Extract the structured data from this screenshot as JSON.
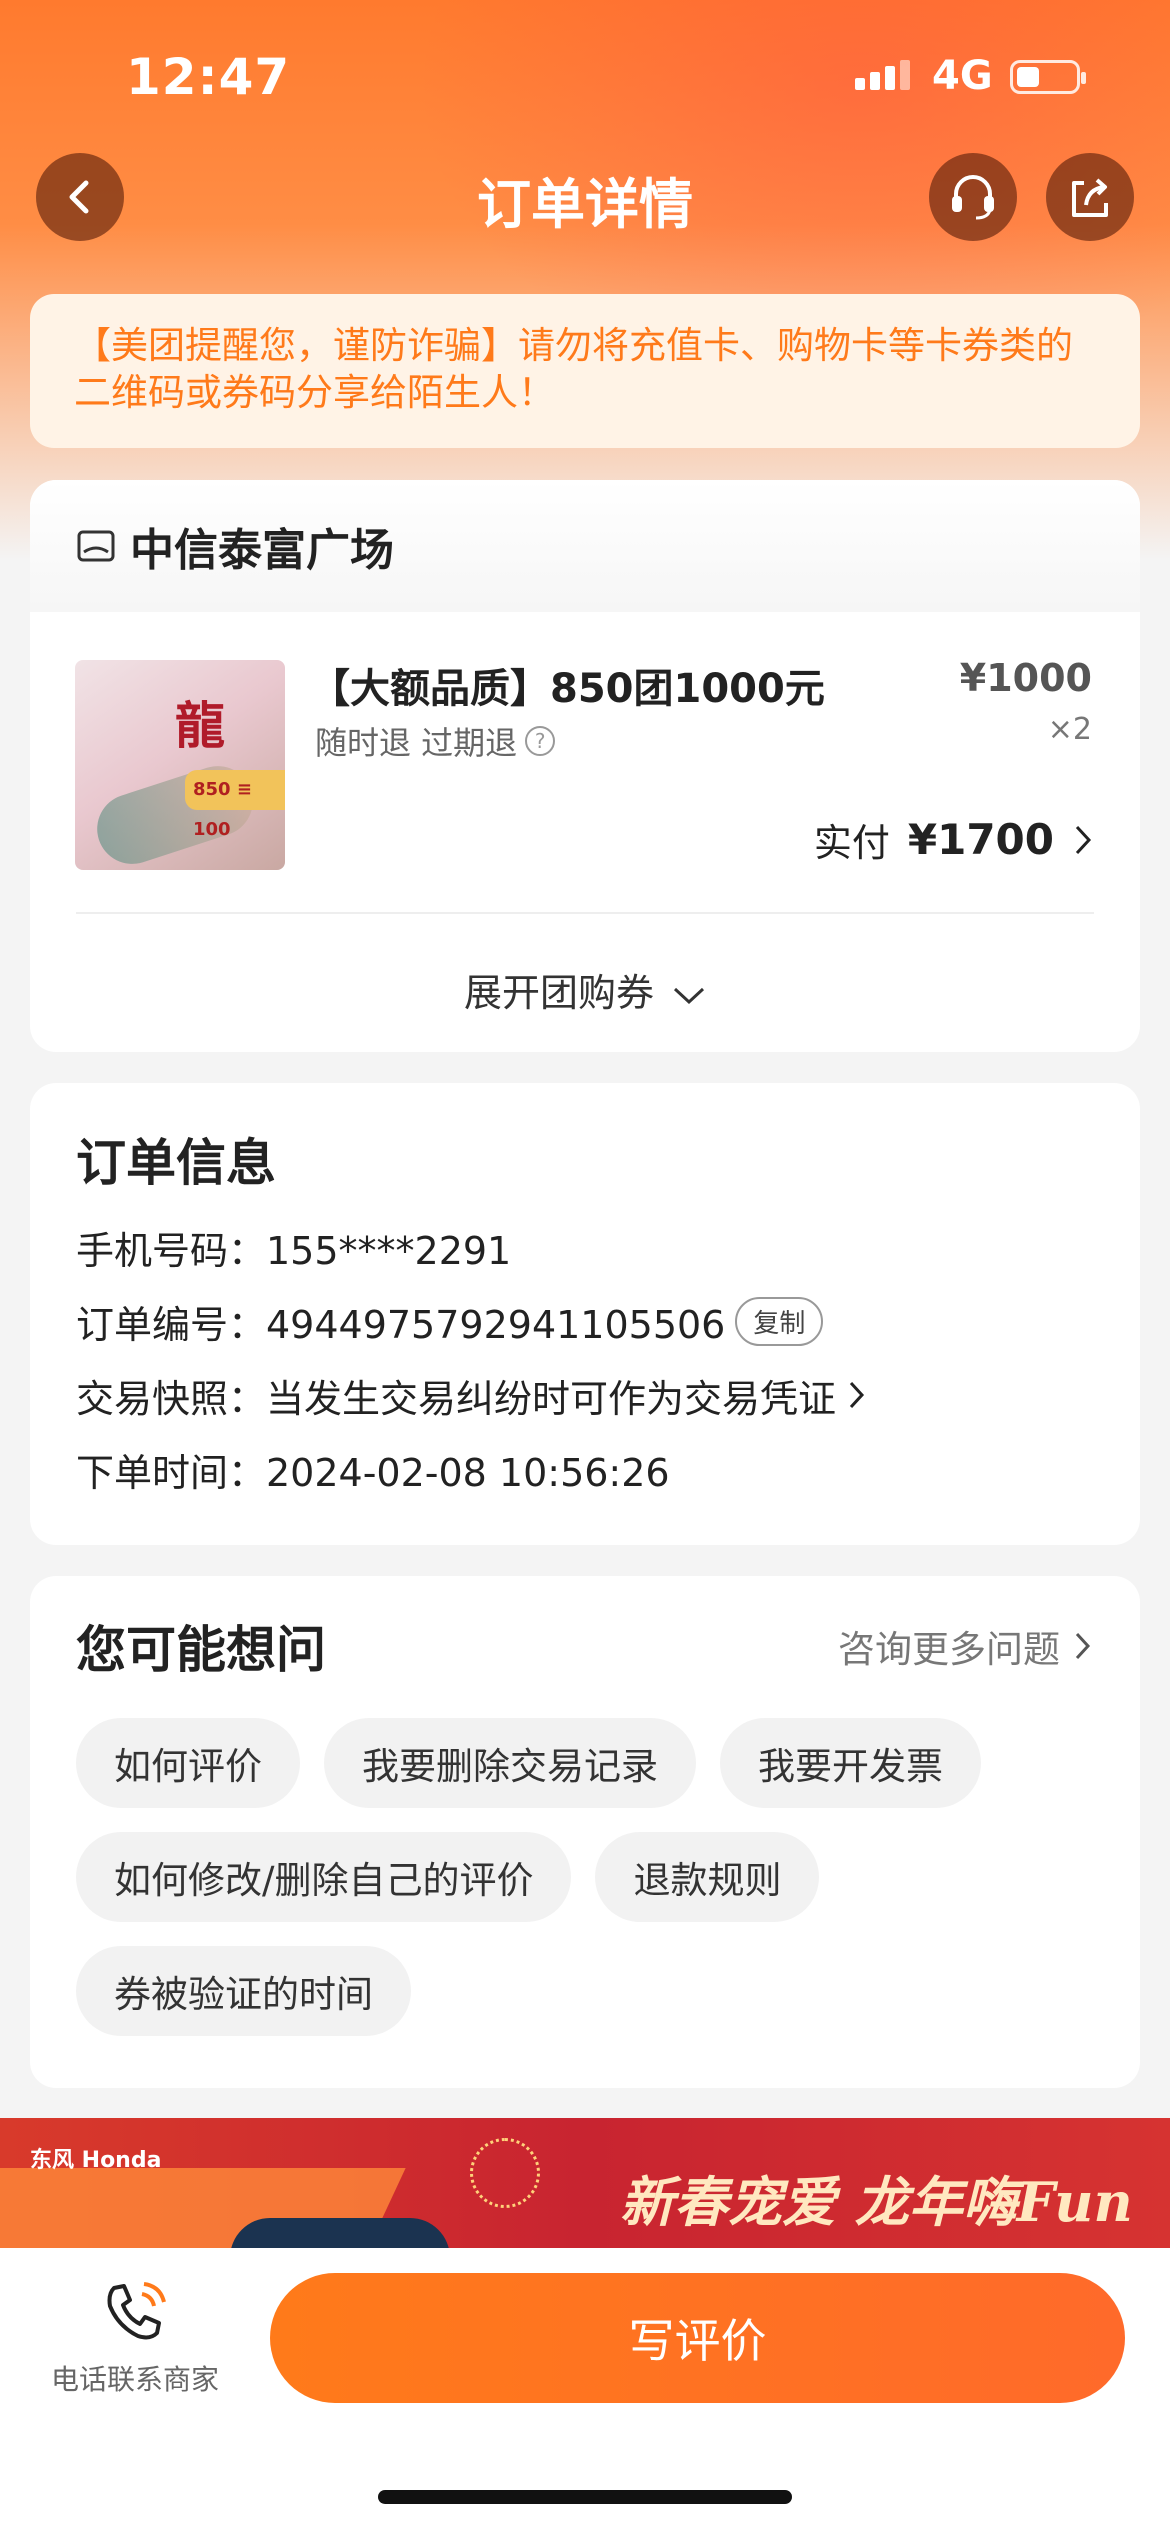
{
  "status_bar": {
    "time": "12:47",
    "network": "4G"
  },
  "nav": {
    "title": "订单详情"
  },
  "fraud_notice": {
    "text": "【美团提醒您，谨防诈骗】请勿将充值卡、购物卡等卡券类的二维码或券码分享给陌生人！"
  },
  "merchant": {
    "name": "中信泰富广场",
    "product": {
      "title": "【大额品质】850团1000元",
      "tags": "随时退  过期退",
      "price": "¥1000",
      "qty": "×2",
      "paid_label": "实付",
      "paid_amount": "¥1700"
    },
    "expand_label": "展开团购券"
  },
  "order_info": {
    "title": "订单信息",
    "phone": "手机号码：155****2291",
    "order_no": "订单编号：4944975792941105506",
    "copy_label": "复制",
    "snapshot": "交易快照：当发生交易纠纷时可作为交易凭证",
    "order_time": "下单时间：2024-02-08 10:56:26"
  },
  "faq": {
    "title": "您可能想问",
    "more_label": "咨询更多问题",
    "chips": [
      "如何评价",
      "我要删除交易记录",
      "我要开发票",
      "如何修改/删除自己的评价",
      "退款规则",
      "券被验证的时间"
    ]
  },
  "banner": {
    "brand": "东风 Honda",
    "slogan": "新春宠爱 龙年嗨Fun"
  },
  "bottom": {
    "call_label": "电话联系商家",
    "review_label": "写评价"
  },
  "colors": {
    "accent": "#ff7a1a",
    "notice_bg": "#fff3e6"
  }
}
